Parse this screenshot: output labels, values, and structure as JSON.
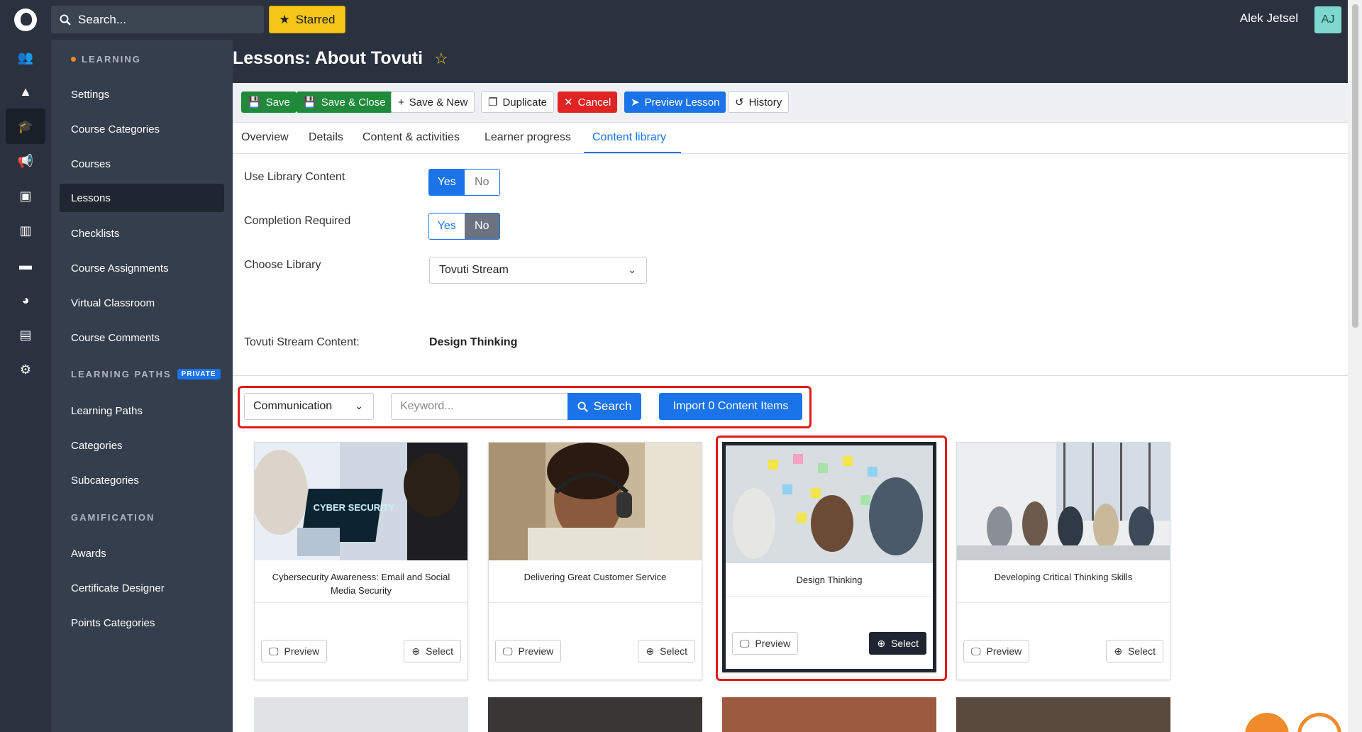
{
  "topbar": {
    "search_placeholder": "Search...",
    "starred_label": "Starred",
    "user_name": "Alek Jetsel",
    "user_initials": "AJ"
  },
  "sidenav": {
    "learning_heading": "LEARNING",
    "learning_items": [
      "Settings",
      "Course Categories",
      "Courses",
      "Lessons",
      "Checklists",
      "Course Assignments",
      "Virtual Classroom",
      "Course Comments"
    ],
    "paths_heading": "LEARNING PATHS",
    "paths_badge": "PRIVATE",
    "paths_items": [
      "Learning Paths",
      "Categories",
      "Subcategories"
    ],
    "gamification_heading": "GAMIFICATION",
    "gamification_items": [
      "Awards",
      "Certificate Designer",
      "Points Categories"
    ],
    "active_item": "Lessons"
  },
  "page": {
    "title": "Lessons: About Tovuti"
  },
  "toolbar": {
    "save": "Save",
    "save_close": "Save & Close",
    "save_new": "Save & New",
    "duplicate": "Duplicate",
    "cancel": "Cancel",
    "preview_lesson": "Preview Lesson",
    "history": "History"
  },
  "tabs": {
    "overview": "Overview",
    "details": "Details",
    "content_activities": "Content & activities",
    "learner_progress": "Learner progress",
    "content_library": "Content library",
    "active": "Content library"
  },
  "form": {
    "use_library_label": "Use Library Content",
    "use_library_value": "Yes",
    "completion_label": "Completion Required",
    "completion_value": "No",
    "yes": "Yes",
    "no": "No",
    "choose_library_label": "Choose Library",
    "choose_library_value": "Tovuti Stream",
    "stream_content_label": "Tovuti Stream Content:",
    "stream_content_value": "Design Thinking"
  },
  "filter": {
    "category_value": "Communication",
    "keyword_placeholder": "Keyword...",
    "search_label": "Search",
    "import_label": "Import 0 Content Items"
  },
  "cards": [
    {
      "title": "Cybersecurity Awareness: Email and Social Media Security",
      "preview": "Preview",
      "select": "Select",
      "image_text": "CYBER SECURITY"
    },
    {
      "title": "Delivering Great Customer Service",
      "preview": "Preview",
      "select": "Select"
    },
    {
      "title": "Design Thinking",
      "preview": "Preview",
      "select": "Select",
      "selected": true
    },
    {
      "title": "Developing Critical Thinking Skills",
      "preview": "Preview",
      "select": "Select"
    }
  ],
  "colors": {
    "primary": "#1a73e8",
    "save_green": "#1e8a3a",
    "cancel_red": "#e02323",
    "highlight_red": "#e01b1b",
    "star_yellow": "#f5c518",
    "sidebar_bg": "#353e4c",
    "topbar_bg": "#2a3240"
  }
}
